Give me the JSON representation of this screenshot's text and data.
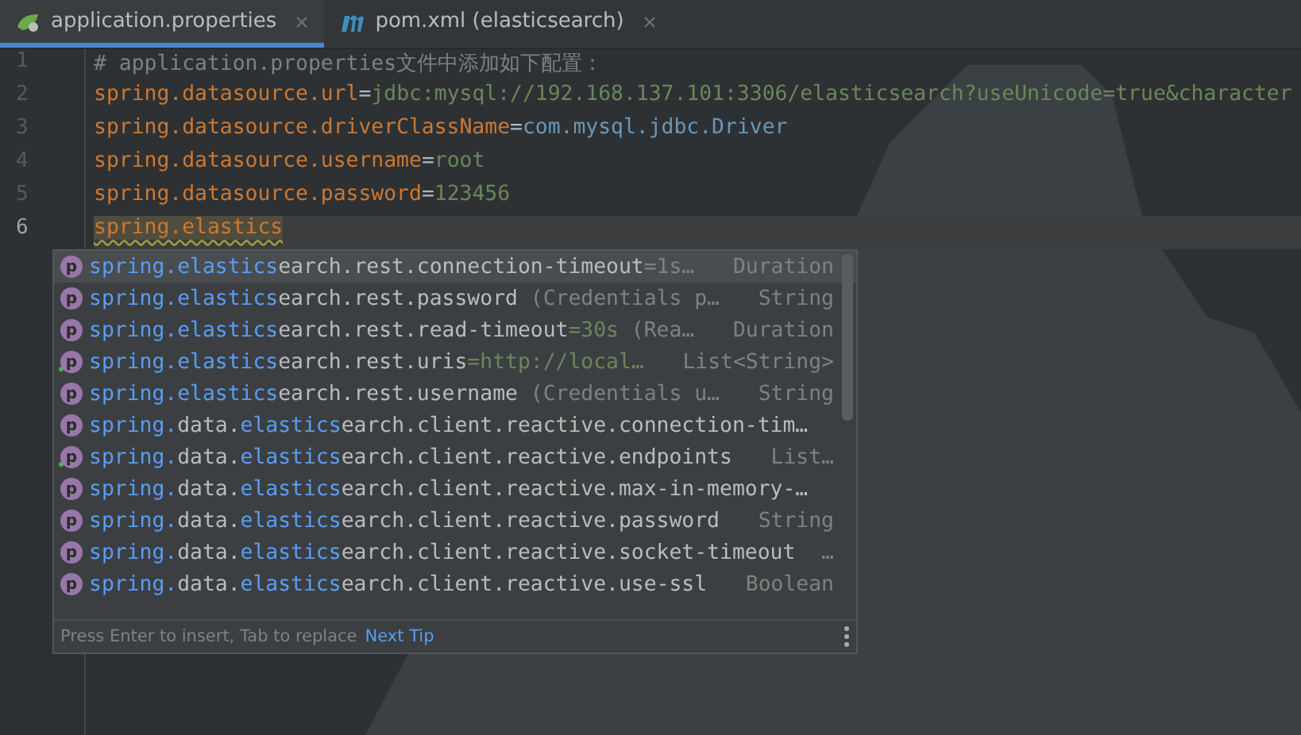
{
  "tabs": [
    {
      "label": "application.properties",
      "selected": true
    },
    {
      "label": "pom.xml (elasticsearch)",
      "selected": false
    }
  ],
  "editor": {
    "lines": [
      {
        "number": "1",
        "current": false,
        "segments": [
          {
            "text": "# application.properties文件中添加如下配置：",
            "kind": "comment"
          }
        ]
      },
      {
        "number": "2",
        "current": false,
        "segments": [
          {
            "text": "spring.datasource.url",
            "kind": "key"
          },
          {
            "text": "=",
            "kind": "eq"
          },
          {
            "text": "jdbc:mysql://192.168.137.101:3306/elasticsearch?useUnicode=true&character",
            "kind": "value"
          }
        ]
      },
      {
        "number": "3",
        "current": false,
        "segments": [
          {
            "text": "spring.datasource.driverClassName",
            "kind": "key"
          },
          {
            "text": "=",
            "kind": "eq"
          },
          {
            "text": "com.mysql.jdbc.Driver",
            "kind": "class"
          }
        ]
      },
      {
        "number": "4",
        "current": false,
        "segments": [
          {
            "text": "spring.datasource.username",
            "kind": "key"
          },
          {
            "text": "=",
            "kind": "eq"
          },
          {
            "text": "root",
            "kind": "value"
          }
        ]
      },
      {
        "number": "5",
        "current": false,
        "segments": [
          {
            "text": "spring.datasource.password",
            "kind": "key"
          },
          {
            "text": "=",
            "kind": "eq"
          },
          {
            "text": "123456",
            "kind": "value"
          }
        ]
      },
      {
        "number": "6",
        "current": true,
        "segments": [
          {
            "text": "spring.elastics",
            "kind": "typing"
          }
        ]
      }
    ]
  },
  "completion": {
    "items": [
      {
        "badge": "p",
        "selected": true,
        "marked": false,
        "segments": [
          {
            "text": "spring.elastics",
            "kind": "match"
          },
          {
            "text": "earch.rest.connection-timeout",
            "kind": "name"
          },
          {
            "text": "=1s…",
            "kind": "hint"
          }
        ],
        "type": "Duration"
      },
      {
        "badge": "p",
        "selected": false,
        "marked": false,
        "segments": [
          {
            "text": "spring.elastics",
            "kind": "match"
          },
          {
            "text": "earch.rest.password",
            "kind": "name"
          },
          {
            "text": " (Credentials p…",
            "kind": "hint"
          }
        ],
        "type": "String"
      },
      {
        "badge": "p",
        "selected": false,
        "marked": false,
        "segments": [
          {
            "text": "spring.elastics",
            "kind": "match"
          },
          {
            "text": "earch.rest.read-timeout",
            "kind": "name"
          },
          {
            "text": "=30s",
            "kind": "value"
          },
          {
            "text": " (Rea…",
            "kind": "hint"
          }
        ],
        "type": "Duration"
      },
      {
        "badge": "p",
        "selected": false,
        "marked": true,
        "segments": [
          {
            "text": "spring.elastics",
            "kind": "match"
          },
          {
            "text": "earch.rest.uris",
            "kind": "name"
          },
          {
            "text": "=http://local…",
            "kind": "value"
          }
        ],
        "type": "List<String>"
      },
      {
        "badge": "p",
        "selected": false,
        "marked": false,
        "segments": [
          {
            "text": "spring.elastics",
            "kind": "match"
          },
          {
            "text": "earch.rest.username",
            "kind": "name"
          },
          {
            "text": " (Credentials u…",
            "kind": "hint"
          }
        ],
        "type": "String"
      },
      {
        "badge": "p",
        "selected": false,
        "marked": false,
        "segments": [
          {
            "text": "spring.",
            "kind": "match"
          },
          {
            "text": "data.",
            "kind": "name"
          },
          {
            "text": "elastics",
            "kind": "match"
          },
          {
            "text": "earch.client.reactive.connection-tim…",
            "kind": "name"
          }
        ]
      },
      {
        "badge": "p",
        "selected": false,
        "marked": true,
        "segments": [
          {
            "text": "spring.",
            "kind": "match"
          },
          {
            "text": "data.",
            "kind": "name"
          },
          {
            "text": "elastics",
            "kind": "match"
          },
          {
            "text": "earch.client.reactive.endpoints",
            "kind": "name"
          }
        ],
        "type": "List…"
      },
      {
        "badge": "p",
        "selected": false,
        "marked": false,
        "segments": [
          {
            "text": "spring.",
            "kind": "match"
          },
          {
            "text": "data.",
            "kind": "name"
          },
          {
            "text": "elastics",
            "kind": "match"
          },
          {
            "text": "earch.client.reactive.max-in-memory-…",
            "kind": "name"
          }
        ]
      },
      {
        "badge": "p",
        "selected": false,
        "marked": false,
        "segments": [
          {
            "text": "spring.",
            "kind": "match"
          },
          {
            "text": "data.",
            "kind": "name"
          },
          {
            "text": "elastics",
            "kind": "match"
          },
          {
            "text": "earch.client.reactive.password",
            "kind": "name"
          }
        ],
        "type": "String"
      },
      {
        "badge": "p",
        "selected": false,
        "marked": false,
        "segments": [
          {
            "text": "spring.",
            "kind": "match"
          },
          {
            "text": "data.",
            "kind": "name"
          },
          {
            "text": "elastics",
            "kind": "match"
          },
          {
            "text": "earch.client.reactive.socket-timeout",
            "kind": "name"
          }
        ],
        "type": "…"
      },
      {
        "badge": "p",
        "selected": false,
        "marked": false,
        "segments": [
          {
            "text": "spring.",
            "kind": "match"
          },
          {
            "text": "data.",
            "kind": "name"
          },
          {
            "text": "elastics",
            "kind": "match"
          },
          {
            "text": "earch.client.reactive.use-ssl",
            "kind": "name"
          }
        ],
        "type": "Boolean"
      }
    ],
    "footer": {
      "hint": "Press Enter to insert, Tab to replace",
      "link": "Next Tip"
    }
  }
}
